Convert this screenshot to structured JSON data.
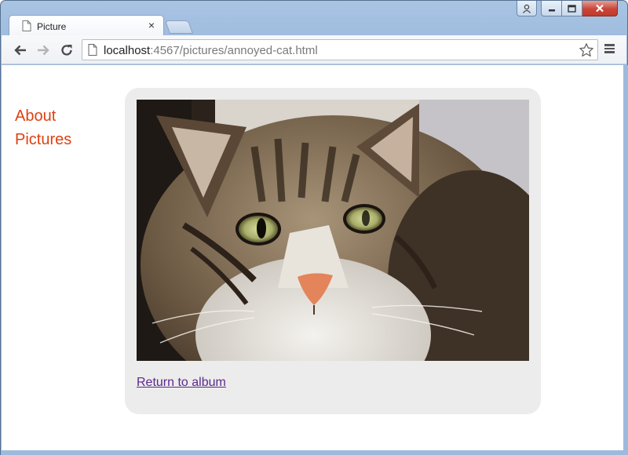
{
  "browser": {
    "tab": {
      "title": "Picture",
      "close_glyph": "×",
      "icon": "page-icon"
    },
    "new_tab_icon": "new-tab-icon",
    "window_controls": {
      "user_icon": "user-icon",
      "minimize_icon": "minimize-icon",
      "maximize_icon": "maximize-icon",
      "close_icon": "close-icon"
    },
    "toolbar": {
      "back_icon": "back-arrow-icon",
      "forward_icon": "forward-arrow-icon",
      "reload_icon": "reload-icon",
      "url_host": "localhost",
      "url_rest": ":4567/pictures/annoyed-cat.html",
      "bookmark_icon": "star-icon",
      "menu_icon": "hamburger-menu-icon"
    }
  },
  "page": {
    "nav": [
      {
        "label": "About"
      },
      {
        "label": "Pictures"
      }
    ],
    "picture": {
      "subject": "annoyed cat photo"
    },
    "return_link": "Return to album"
  },
  "colors": {
    "nav_link": "#e04010",
    "visited_link": "#5a2a8c",
    "card_background": "#ececec",
    "window_frame": "#9dbadd",
    "close_button": "#c9463a"
  }
}
